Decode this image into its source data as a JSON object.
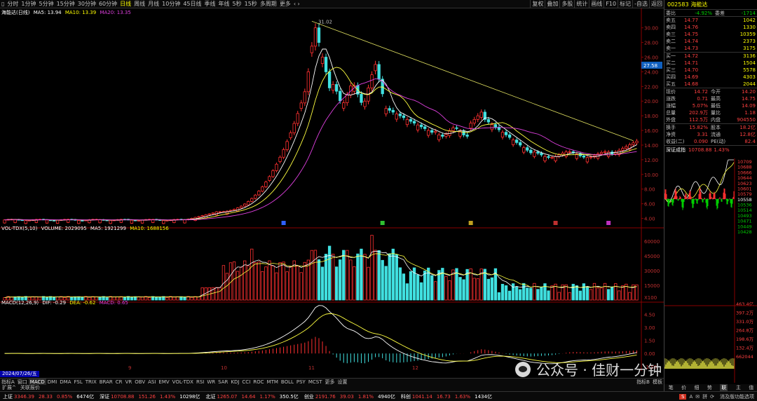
{
  "top_bar": {
    "menu_icon": "menu-icon",
    "periods": [
      "分时",
      "1分钟",
      "5分钟",
      "15分钟",
      "30分钟",
      "60分钟",
      "日线",
      "周线",
      "月线",
      "10分钟",
      "45日线",
      "季线",
      "年线",
      "5秒",
      "15秒",
      "多周期",
      "更多"
    ],
    "active_period": "日线",
    "tools": [
      "复权",
      "叠加",
      "多股",
      "统计",
      "画线",
      "F10",
      "标记",
      "-自选",
      "返回"
    ]
  },
  "legends": {
    "ma_line": {
      "name": "海能达(日线)",
      "ma5": "MA5: 13.94",
      "ma10": "MA10: 13.39",
      "ma20": "MA20: 13.35"
    },
    "vol_line": {
      "name": "VOL-TDX(5,10)",
      "volume": "VOLUME: 2029095",
      "ma5": "MA5: 1921299",
      "ma10": "MA10: 1688156"
    },
    "macd_line": {
      "name": "MACD(12,26,9)",
      "dif": "DIF: -0.29",
      "dea": "DEA: -0.62",
      "macd": "MACD: 0.65"
    }
  },
  "date_label": "2024/07/26/五",
  "axes": {
    "price_ticks": [
      "30.00",
      "28.00",
      "26.00",
      "24.00",
      "22.00",
      "20.00",
      "18.00",
      "16.00",
      "14.00",
      "12.00",
      "10.00",
      "8.00",
      "6.00",
      "4.00"
    ],
    "price_current": "27.58",
    "price_annot": "31.02",
    "vol_ticks": [
      "60000",
      "45000",
      "30000",
      "15000"
    ],
    "vol_unit": "X100",
    "macd_ticks": [
      "4.50",
      "3.00",
      "1.50",
      "0.00",
      "-1.50"
    ],
    "x_labels": [
      "9",
      "10",
      "11",
      "12"
    ]
  },
  "chart_data": [
    {
      "type": "candlestick",
      "title": "海能达(日线)",
      "y_range": [
        3,
        31.5
      ],
      "peak_label": "31.02",
      "series_names": [
        "MA5",
        "MA10",
        "MA20"
      ]
    },
    {
      "type": "bar",
      "title": "VOL-TDX(5,10)",
      "y_range": [
        0,
        70000
      ],
      "unit": "X100"
    },
    {
      "type": "bar",
      "title": "MACD(12,26,9)",
      "y_range": [
        -2,
        5.5
      ]
    }
  ],
  "tabs": [
    "指标A",
    "窗口",
    "MACD",
    "DMI",
    "DMA",
    "FSL",
    "TRIX",
    "BRAR",
    "CR",
    "VR",
    "OBV",
    "ASI",
    "EMV",
    "VOL-TDX",
    "RSI",
    "WR",
    "SAR",
    "KDJ",
    "CCI",
    "ROC",
    "MTM",
    "BOLL",
    "PSY",
    "MCST",
    "更多",
    "设置"
  ],
  "active_tab": "MACD",
  "tabs_right": [
    "指标B",
    "模板"
  ],
  "sub_tabs": [
    "扩展^",
    "关联报价"
  ],
  "quote": {
    "code": "002583",
    "name": "海能达",
    "weibi_label": "委比",
    "weibi": "-4.92%",
    "weicha_label": "委差",
    "weicha": "-1714",
    "asks": [
      {
        "l": "卖五",
        "p": "14.77",
        "v": "1042"
      },
      {
        "l": "卖四",
        "p": "14.76",
        "v": "1330"
      },
      {
        "l": "卖三",
        "p": "14.75",
        "v": "10359"
      },
      {
        "l": "卖二",
        "p": "14.74",
        "v": "2373"
      },
      {
        "l": "卖一",
        "p": "14.73",
        "v": "3175"
      }
    ],
    "bids": [
      {
        "l": "买一",
        "p": "14.72",
        "v": "3136"
      },
      {
        "l": "买二",
        "p": "14.71",
        "v": "1504"
      },
      {
        "l": "买三",
        "p": "14.70",
        "v": "5578"
      },
      {
        "l": "买四",
        "p": "14.69",
        "v": "4303"
      },
      {
        "l": "买五",
        "p": "14.68",
        "v": "2044"
      }
    ],
    "stats": [
      {
        "a": "现价",
        "b": "14.72",
        "c": "今开",
        "d": "14.20"
      },
      {
        "a": "涨跌",
        "b": "0.71",
        "c": "最高",
        "d": "14.75"
      },
      {
        "a": "涨幅",
        "b": "5.07%",
        "c": "最低",
        "d": "14.09"
      },
      {
        "a": "总量",
        "b": "202.9万",
        "c": "量比",
        "d": "1.18"
      },
      {
        "a": "外盘",
        "b": "112.5万",
        "c": "内盘",
        "d": "904550"
      }
    ],
    "stats2": [
      {
        "a": "换手",
        "b": "15.82%",
        "c": "股本",
        "d": "18.2亿"
      },
      {
        "a": "净资",
        "b": "3.31",
        "c": "流通",
        "d": "12.8亿"
      },
      {
        "a": "收益(二)",
        "b": "0.090",
        "c": "PE(动)",
        "d": "82.4"
      }
    ]
  },
  "index_chart": {
    "title": "深证成指",
    "value": "10708.88",
    "pct": "1.43%",
    "y_ticks": [
      "10709",
      "10688",
      "10666",
      "10644",
      "10623",
      "10601",
      "10579",
      "10558",
      "10536",
      "10514",
      "10493",
      "10471",
      "10449",
      "10428"
    ],
    "vol_ticks": [
      "463.4亿",
      "397.2万",
      "331.0万",
      "264.8万",
      "198.6万",
      "132.4万",
      "662044"
    ],
    "bottom_tabs": [
      "笔",
      "价",
      "细",
      "势",
      "联",
      "主",
      "值"
    ],
    "active_bottom": "联"
  },
  "status": [
    {
      "name": "上证",
      "val": "3346.39",
      "chg": "28.33",
      "pct": "0.85%",
      "amt": "6474亿"
    },
    {
      "name": "深证",
      "val": "10708.88",
      "chg": "151.26",
      "pct": "1.43%",
      "amt": "10298亿"
    },
    {
      "name": "北证",
      "val": "1265.07",
      "chg": "14.64",
      "pct": "1.17%",
      "amt": "350.5亿"
    },
    {
      "name": "创业",
      "val": "2191.76",
      "chg": "39.03",
      "pct": "1.81%",
      "amt": "4940亿"
    },
    {
      "name": "科创",
      "val": "1041.14",
      "chg": "16.73",
      "pct": "1.63%",
      "amt": "1434亿"
    }
  ],
  "status_right": "消及版功能选项",
  "watermark": "公众号 · 佳财一分钟"
}
